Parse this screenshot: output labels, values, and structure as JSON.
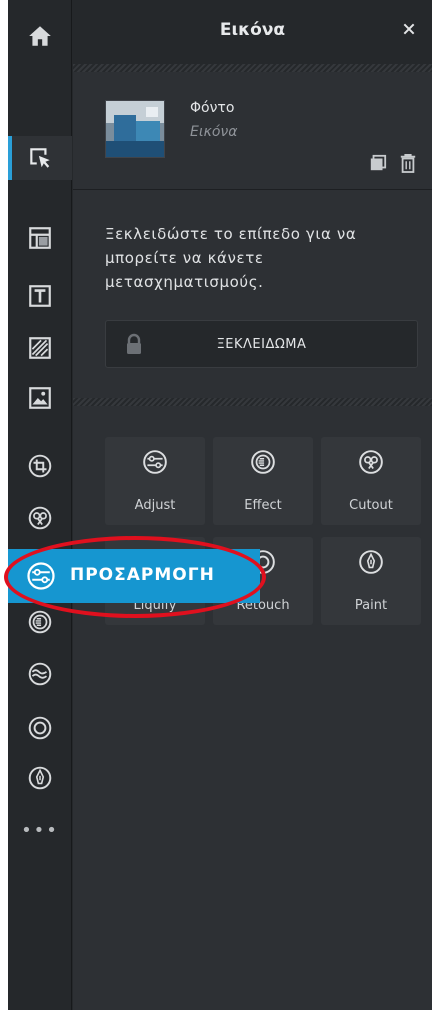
{
  "panel": {
    "title": "Εικόνα",
    "close": "×"
  },
  "layer": {
    "name": "Φόντο",
    "type": "Εικόνα"
  },
  "info": {
    "message": "Ξεκλειδώστε το επίπεδο για να μπορείτε να κάνετε μετασχηματισμούς."
  },
  "unlock": {
    "label": "ΞΕΚΛΕΙΔΩΜΑ"
  },
  "tools": [
    {
      "label": "Adjust",
      "icon": "adjust-icon"
    },
    {
      "label": "Effect",
      "icon": "effect-icon"
    },
    {
      "label": "Cutout",
      "icon": "cutout-icon"
    },
    {
      "label": "Liquify",
      "icon": "liquify-icon"
    },
    {
      "label": "Retouch",
      "icon": "retouch-icon"
    },
    {
      "label": "Paint",
      "icon": "paint-icon"
    }
  ],
  "toolbar": {
    "items": [
      "home-icon",
      "arrange-icon",
      "layout-icon",
      "text-icon",
      "texture-icon",
      "image-icon",
      "crop-icon",
      "cutout-icon",
      "adjust-icon",
      "effect-icon",
      "liquify-icon",
      "retouch-icon",
      "paint-icon",
      "more-icon"
    ],
    "more": "•••"
  },
  "highlight": {
    "label": "ΠΡΟΣΑΡΜΟΓΗ"
  },
  "colors": {
    "accent": "#2a9fd8",
    "highlight": "#1696d0",
    "ring": "#e0101e",
    "panel": "#2d3034",
    "toolbar": "#25282b"
  }
}
